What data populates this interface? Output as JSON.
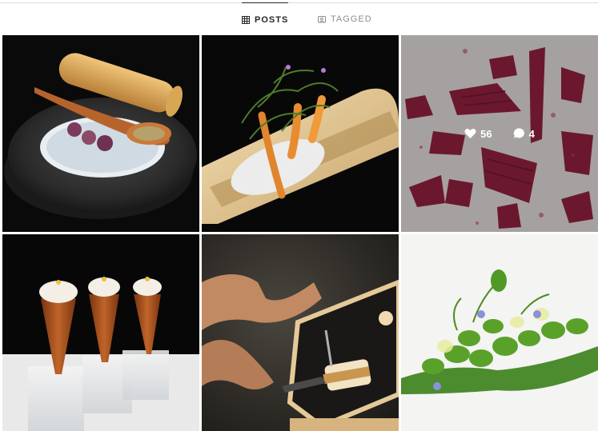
{
  "tabs": [
    {
      "label": "POSTS",
      "icon": "grid-icon",
      "active": true
    },
    {
      "label": "TAGGED",
      "icon": "tag-portrait-icon",
      "active": false
    }
  ],
  "posts": [
    {
      "subject": "dessert-bowl",
      "colors": {
        "bg": "#0d0d0d",
        "accent": "#d9a656"
      }
    },
    {
      "subject": "bamboo-carrots",
      "colors": {
        "bg": "#0b0b0b",
        "accent": "#e2c58a"
      }
    },
    {
      "subject": "chocolate-shards",
      "colors": {
        "bg": "#d9d5d4",
        "accent": "#8a1f3c"
      },
      "overlay": {
        "likes": "56",
        "comments": "4"
      }
    },
    {
      "subject": "cones-on-glass",
      "colors": {
        "bg": "#0a0a0a",
        "accent": "#9a4a15"
      }
    },
    {
      "subject": "chef-plating",
      "colors": {
        "bg": "#2c2a26",
        "accent": "#f0d59a"
      }
    },
    {
      "subject": "green-beans-plate",
      "colors": {
        "bg": "#f3f3f1",
        "accent": "#3f8a1e"
      }
    }
  ]
}
